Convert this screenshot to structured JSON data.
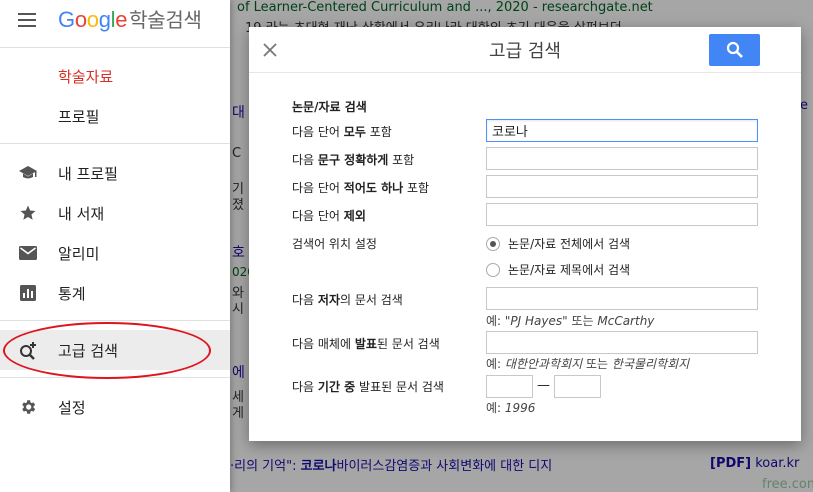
{
  "background": {
    "top_line1": "of Learner-Centered Curriculum and ..., 2020 - researchgate.net",
    "top_line2": "19 라는 초대형 재난 상황에서 우리나라 대한의 초기 대응을 살펴보던",
    "left_fragments": [
      "대",
      "C",
      "기",
      "졌",
      "호",
      "020",
      "와",
      "시",
      "에",
      "세",
      "게"
    ],
    "right_fragment": "e",
    "bottom_snippet_pre": "·리의 기억\": ",
    "bottom_snippet_bold": "코로나",
    "bottom_snippet_post": "바이러스감염증과 사회변화에 대한 디지",
    "pdf_tag": "[PDF]",
    "pdf_source": "koar.kr",
    "watermark": "free.com"
  },
  "drawer": {
    "logo_letters": [
      "G",
      "o",
      "o",
      "g",
      "l",
      "e"
    ],
    "logo_suffix": "학술검색",
    "items": [
      {
        "label": "학술자료"
      },
      {
        "label": "프로필"
      },
      {
        "label": "내 프로필",
        "icon": "graduation-cap-icon"
      },
      {
        "label": "내 서재",
        "icon": "star-icon"
      },
      {
        "label": "알리미",
        "icon": "mail-icon"
      },
      {
        "label": "통계",
        "icon": "stats-icon"
      },
      {
        "label": "고급 검색",
        "icon": "advanced-search-icon"
      },
      {
        "label": "설정",
        "icon": "gear-icon"
      }
    ]
  },
  "dialog": {
    "title": "고급 검색",
    "section_title": "논문/자료 검색",
    "all_words": {
      "pre": "다음 단어 ",
      "bold": "모두",
      "post": " 포함",
      "value": "코로나"
    },
    "exact_phrase": {
      "pre": "다음 ",
      "bold": "문구 정확하게",
      "post": " 포함",
      "value": ""
    },
    "at_least_one": {
      "pre": "다음 단어 ",
      "bold": "적어도 하나",
      "post": " 포함",
      "value": ""
    },
    "without": {
      "pre": "다음 단어 ",
      "bold": "제외",
      "post": "",
      "value": ""
    },
    "where_label": "검색어 위치 설정",
    "where_options": [
      {
        "label": "논문/자료 전체에서 검색",
        "checked": true
      },
      {
        "label": "논문/자료 제목에서 검색",
        "checked": false
      }
    ],
    "author": {
      "pre": "다음 ",
      "bold": "저자",
      "post": "의 문서 검색",
      "value": "",
      "example_prefix": "예: ",
      "example_a": "\"PJ Hayes\"",
      "example_mid": " 또는 ",
      "example_b": "McCarthy"
    },
    "publication": {
      "pre": "다음 매체에 ",
      "bold": "발표",
      "post": "된 문서 검색",
      "value": "",
      "example_prefix": "예: ",
      "example_a": "대한안과학회지",
      "example_mid": " 또는 ",
      "example_b": "한국물리학회지"
    },
    "date": {
      "pre": "다음 ",
      "bold": "기간 중",
      "post": " 발표된 문서 검색",
      "from": "",
      "to": "",
      "dash": "—",
      "example_prefix": "예: ",
      "example_a": "1996"
    }
  },
  "colors": {
    "accent": "#4285f4",
    "active_nav": "#d93025",
    "annotation": "#e0141e"
  }
}
